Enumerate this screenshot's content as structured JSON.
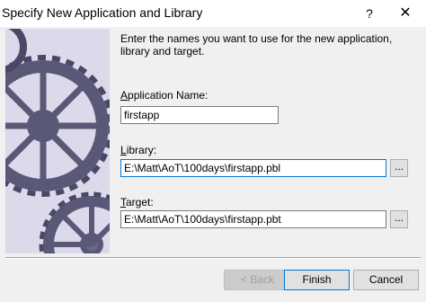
{
  "window": {
    "title": "Specify New Application and Library",
    "help_glyph": "?",
    "close_glyph": "✕"
  },
  "instructions": "Enter the names you want to use for the new application, library and target.",
  "fields": {
    "application": {
      "label_hotkey": "A",
      "label_rest": "pplication Name:",
      "value": "firstapp"
    },
    "library": {
      "label_hotkey": "L",
      "label_rest": "ibrary:",
      "value": "E:\\Matt\\AoT\\100days\\firstapp.pbl",
      "browse": "..."
    },
    "target": {
      "label_hotkey": "T",
      "label_rest": "arget:",
      "value": "E:\\Matt\\AoT\\100days\\firstapp.pbt",
      "browse": "..."
    }
  },
  "buttons": {
    "back": "< Back",
    "finish": "Finish",
    "cancel": "Cancel"
  },
  "colors": {
    "gear": "#5a5877",
    "gear_dark": "#3c3a55",
    "art_bg": "#dcd9ea",
    "focus_border": "#0078d7"
  },
  "icons": {
    "help": "help-icon",
    "close": "close-icon",
    "gears": "gears-illustration"
  }
}
